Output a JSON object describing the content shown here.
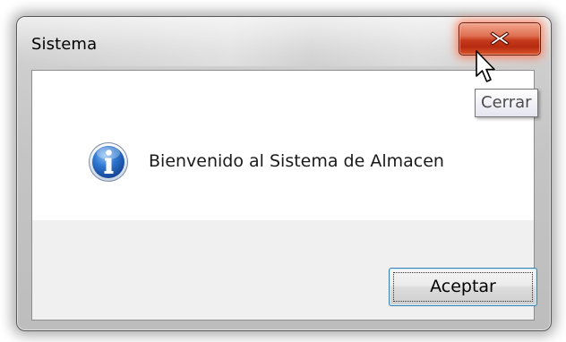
{
  "window": {
    "title": "Sistema",
    "close_icon": "close-icon",
    "close_tooltip": "Cerrar"
  },
  "dialog": {
    "icon": "info-icon",
    "message": "Bienvenido al Sistema de Almacen",
    "ok_label": "Aceptar"
  },
  "colors": {
    "close_button": "#c5391b",
    "button_focus_border": "#3c7fb1",
    "info_icon_blue": "#1d5fb8"
  }
}
